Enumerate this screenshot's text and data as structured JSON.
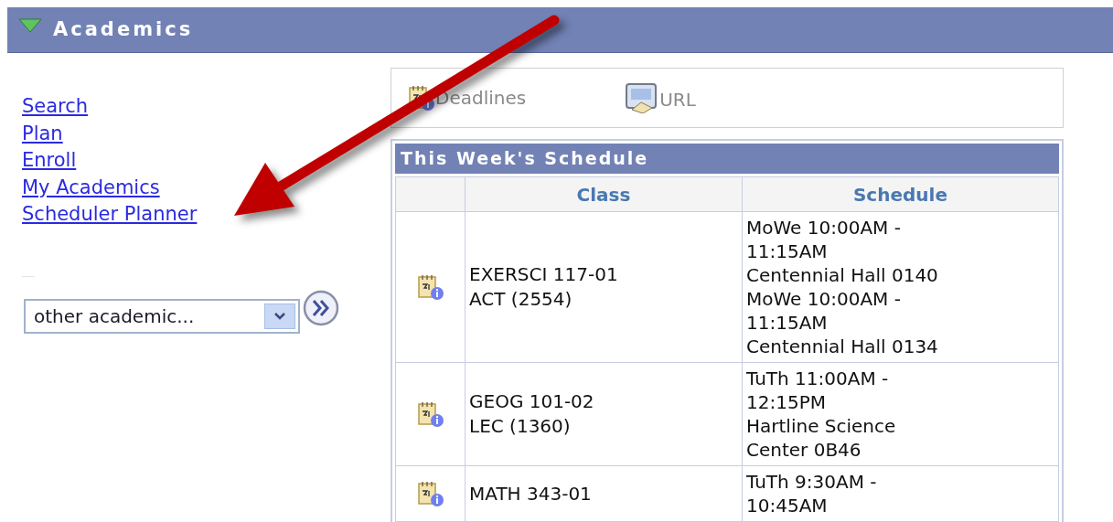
{
  "header": {
    "title": "Academics",
    "expanded": true
  },
  "links": [
    "Search",
    "Plan",
    "Enroll",
    "My Academics",
    "Scheduler Planner"
  ],
  "dropdown": {
    "value": "other academic..."
  },
  "toolbar": [
    {
      "kind": "deadlines",
      "label": "Deadlines"
    },
    {
      "kind": "url",
      "label": "URL"
    }
  ],
  "schedule": {
    "title": "This Week's Schedule",
    "columns": [
      "Class",
      "Schedule"
    ],
    "rows": [
      {
        "class": [
          "EXERSCI 117-01",
          "ACT (2554)"
        ],
        "schedule": [
          "MoWe 10:00AM -",
          "11:15AM",
          "Centennial Hall 0140",
          "MoWe 10:00AM -",
          "11:15AM",
          "Centennial Hall 0134"
        ]
      },
      {
        "class": [
          "GEOG 101-02",
          "LEC (1360)"
        ],
        "schedule": [
          "TuTh 11:00AM -",
          "12:15PM",
          "Hartline Science",
          "Center 0B46"
        ]
      },
      {
        "class": [
          "MATH 343-01"
        ],
        "schedule": [
          "TuTh 9:30AM -",
          "10:45AM"
        ]
      }
    ]
  }
}
